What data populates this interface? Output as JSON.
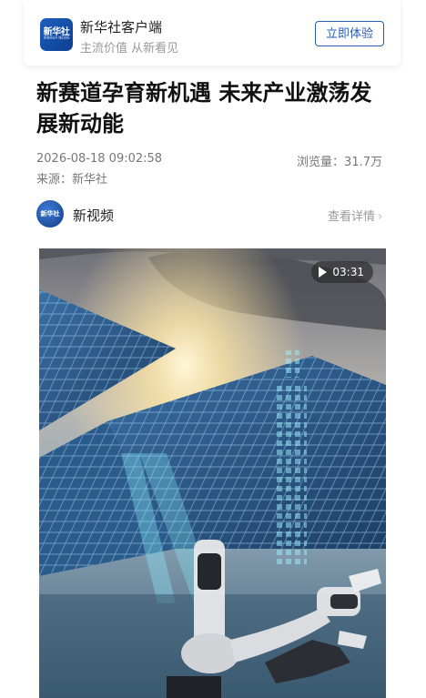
{
  "banner": {
    "logo_text": "新华社",
    "logo_sub": "XINHUA NEWS",
    "app_name": "新华社客户端",
    "slogan": "主流价值 从新看见",
    "cta_label": "立即体验"
  },
  "article": {
    "headline": "新赛道孕育新机遇 未来产业激荡发展新动能",
    "date": "2026-08-18 09:02:58",
    "views_label": "浏览量：31.7万",
    "source_label": "来源：新华社"
  },
  "channel": {
    "avatar_text": "新华社",
    "name": "新视频",
    "detail_label": "查看详情",
    "detail_chevron": "›"
  },
  "video": {
    "duration": "03:31",
    "play_icon": "play-icon",
    "scene": "solar-panels-ai-robot-hand"
  },
  "colors": {
    "brand_blue": "#2a5db0",
    "meta_gray": "#777777"
  }
}
